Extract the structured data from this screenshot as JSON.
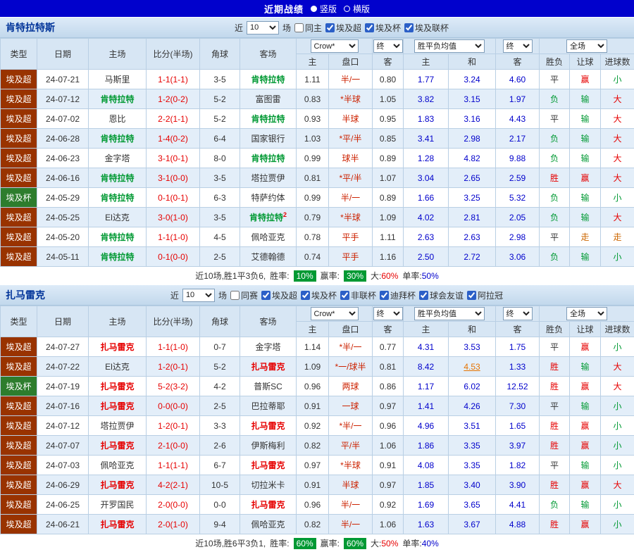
{
  "topbar": {
    "title": "近期战绩",
    "layout_options": [
      {
        "label": "竖版",
        "selected": true
      },
      {
        "label": "横版",
        "selected": false
      }
    ]
  },
  "filter_common": {
    "near": "近",
    "count": "10",
    "games": "场"
  },
  "table_header": {
    "type": "类型",
    "date": "日期",
    "home": "主场",
    "score": "比分(半场)",
    "corner": "角球",
    "away": "客场",
    "odds_source": "Crow*",
    "final": "终",
    "avg": "胜平负均值",
    "scope": "全场",
    "asian_home": "主",
    "handicap": "盘口",
    "asian_away": "客",
    "euro_home": "主",
    "euro_draw": "和",
    "euro_away": "客",
    "result": "胜负",
    "handicap_result": "让球",
    "goals": "进球数"
  },
  "colors": {
    "topbar_blue": "#0101cc",
    "league_super_bg": "#993300",
    "league_cup_bg": "#2d7d2d",
    "team1_highlight": "#009933",
    "team2_highlight": "#e60000",
    "handicap_red": "#cc2200",
    "euro_odds_blue": "#0000cc",
    "badge_green": "#009933",
    "push_orange": "#cc6600"
  },
  "sections": [
    {
      "team": "肯特拉特斯",
      "filter": {
        "same": {
          "label": "同主",
          "checked": false
        },
        "leagues": [
          {
            "label": "埃及超",
            "checked": true
          },
          {
            "label": "埃及杯",
            "checked": true
          },
          {
            "label": "埃及联杯",
            "checked": true
          }
        ]
      },
      "rows": [
        {
          "type": "埃及超",
          "type_cls": "super",
          "date": "24-07-21",
          "home": "马斯里",
          "home_hl": false,
          "score": "1-1(1-1)",
          "corner": "3-5",
          "away": "肯特拉特",
          "away_hl": true,
          "ah": "1.11",
          "hc": "半/一",
          "aa": "0.80",
          "eh": "1.77",
          "ed": "3.24",
          "ea": "4.60",
          "r1": "平",
          "r2": "赢",
          "r3": "小"
        },
        {
          "type": "埃及超",
          "type_cls": "super",
          "date": "24-07-12",
          "home": "肯特拉特",
          "home_hl": true,
          "score": "1-2(0-2)",
          "corner": "5-2",
          "away": "富图雷",
          "away_hl": false,
          "ah": "0.83",
          "hc": "*半球",
          "aa": "1.05",
          "eh": "3.82",
          "ed": "3.15",
          "ea": "1.97",
          "r1": "负",
          "r2": "输",
          "r3": "大"
        },
        {
          "type": "埃及超",
          "type_cls": "super",
          "date": "24-07-02",
          "home": "恩比",
          "home_hl": false,
          "score": "2-2(1-1)",
          "corner": "5-2",
          "away": "肯特拉特",
          "away_hl": true,
          "ah": "0.93",
          "hc": "半球",
          "aa": "0.95",
          "eh": "1.83",
          "ed": "3.16",
          "ea": "4.43",
          "r1": "平",
          "r2": "输",
          "r3": "大"
        },
        {
          "type": "埃及超",
          "type_cls": "super",
          "date": "24-06-28",
          "home": "肯特拉特",
          "home_hl": true,
          "score": "1-4(0-2)",
          "corner": "6-4",
          "away": "国家银行",
          "away_hl": false,
          "ah": "1.03",
          "hc": "*平/半",
          "aa": "0.85",
          "eh": "3.41",
          "ed": "2.98",
          "ea": "2.17",
          "r1": "负",
          "r2": "输",
          "r3": "大"
        },
        {
          "type": "埃及超",
          "type_cls": "super",
          "date": "24-06-23",
          "home": "金字塔",
          "home_hl": false,
          "score": "3-1(0-1)",
          "corner": "8-0",
          "away": "肯特拉特",
          "away_hl": true,
          "ah": "0.99",
          "hc": "球半",
          "aa": "0.89",
          "eh": "1.28",
          "ed": "4.82",
          "ea": "9.88",
          "r1": "负",
          "r2": "输",
          "r3": "大"
        },
        {
          "type": "埃及超",
          "type_cls": "super",
          "date": "24-06-16",
          "home": "肯特拉特",
          "home_hl": true,
          "score": "3-1(0-0)",
          "corner": "3-5",
          "away": "塔拉贾伊",
          "away_hl": false,
          "ah": "0.81",
          "hc": "*平/半",
          "aa": "1.07",
          "eh": "3.04",
          "ed": "2.65",
          "ea": "2.59",
          "r1": "胜",
          "r2": "赢",
          "r3": "大"
        },
        {
          "type": "埃及杯",
          "type_cls": "cup",
          "date": "24-05-29",
          "home": "肯特拉特",
          "home_hl": true,
          "score": "0-1(0-1)",
          "corner": "6-3",
          "away": "特萨约体",
          "away_hl": false,
          "ah": "0.99",
          "hc": "半/一",
          "aa": "0.89",
          "eh": "1.66",
          "ed": "3.25",
          "ea": "5.32",
          "r1": "负",
          "r2": "输",
          "r3": "小"
        },
        {
          "type": "埃及超",
          "type_cls": "super",
          "date": "24-05-25",
          "home": "El达克",
          "home_hl": false,
          "score": "3-0(1-0)",
          "corner": "3-5",
          "away": "肯特拉特",
          "away_hl": true,
          "away_sup": "2",
          "ah": "0.79",
          "hc": "*半球",
          "aa": "1.09",
          "eh": "4.02",
          "ed": "2.81",
          "ea": "2.05",
          "r1": "负",
          "r2": "输",
          "r3": "大"
        },
        {
          "type": "埃及超",
          "type_cls": "super",
          "date": "24-05-20",
          "home": "肯特拉特",
          "home_hl": true,
          "score": "1-1(1-0)",
          "corner": "4-5",
          "away": "佩哈亚克",
          "away_hl": false,
          "ah": "0.78",
          "hc": "平手",
          "aa": "1.11",
          "eh": "2.63",
          "ed": "2.63",
          "ea": "2.98",
          "r1": "平",
          "r2": "走",
          "r3": "走"
        },
        {
          "type": "埃及超",
          "type_cls": "super",
          "date": "24-05-11",
          "home": "肯特拉特",
          "home_hl": true,
          "score": "0-1(0-0)",
          "corner": "2-5",
          "away": "艾德翰德",
          "away_hl": false,
          "ah": "0.74",
          "hc": "平手",
          "aa": "1.16",
          "eh": "2.50",
          "ed": "2.72",
          "ea": "3.06",
          "r1": "负",
          "r2": "输",
          "r3": "小"
        }
      ],
      "footer": {
        "summary": "近10场,胜1平3负6,",
        "win_label": "胜率:",
        "win_rate": "10%",
        "profit_label": "赢率:",
        "profit_rate": "30%",
        "big_label": "大:",
        "big_rate": "60%",
        "single_label": "单率:",
        "single_rate": "50%"
      }
    },
    {
      "team": "扎马雷克",
      "filter": {
        "same": {
          "label": "同赛",
          "checked": false
        },
        "leagues": [
          {
            "label": "埃及超",
            "checked": true
          },
          {
            "label": "埃及杯",
            "checked": true
          },
          {
            "label": "非联杯",
            "checked": true
          },
          {
            "label": "迪拜杯",
            "checked": true
          },
          {
            "label": "球会友谊",
            "checked": true
          },
          {
            "label": "阿拉冠",
            "checked": true
          }
        ]
      },
      "rows": [
        {
          "type": "埃及超",
          "type_cls": "super",
          "date": "24-07-27",
          "home": "扎马雷克",
          "home_hl": true,
          "score": "1-1(1-0)",
          "corner": "0-7",
          "away": "金字塔",
          "away_hl": false,
          "ah": "1.14",
          "hc": "*半/一",
          "aa": "0.77",
          "eh": "4.31",
          "ed": "3.53",
          "ea": "1.75",
          "r1": "平",
          "r2": "赢",
          "r3": "小"
        },
        {
          "type": "埃及超",
          "type_cls": "super",
          "date": "24-07-22",
          "home": "El达克",
          "home_hl": false,
          "score": "1-2(0-1)",
          "corner": "5-2",
          "away": "扎马雷克",
          "away_hl": true,
          "ah": "1.09",
          "hc": "*一/球半",
          "aa": "0.81",
          "eh": "8.42",
          "ed": "4.53",
          "ed_hl": true,
          "ea": "1.33",
          "r1": "胜",
          "r2": "输",
          "r3": "大"
        },
        {
          "type": "埃及杯",
          "type_cls": "cup",
          "date": "24-07-19",
          "home": "扎马雷克",
          "home_hl": true,
          "score": "5-2(3-2)",
          "corner": "4-2",
          "away": "普斯SC",
          "away_hl": false,
          "ah": "0.96",
          "hc": "两球",
          "aa": "0.86",
          "eh": "1.17",
          "ed": "6.02",
          "ea": "12.52",
          "r1": "胜",
          "r2": "赢",
          "r3": "大"
        },
        {
          "type": "埃及超",
          "type_cls": "super",
          "date": "24-07-16",
          "home": "扎马雷克",
          "home_hl": true,
          "score": "0-0(0-0)",
          "corner": "2-5",
          "away": "巴拉蒂耶",
          "away_hl": false,
          "ah": "0.91",
          "hc": "一球",
          "aa": "0.97",
          "eh": "1.41",
          "ed": "4.26",
          "ea": "7.30",
          "r1": "平",
          "r2": "输",
          "r3": "小"
        },
        {
          "type": "埃及超",
          "type_cls": "super",
          "date": "24-07-12",
          "home": "塔拉贾伊",
          "home_hl": false,
          "score": "1-2(0-1)",
          "corner": "3-3",
          "away": "扎马雷克",
          "away_hl": true,
          "ah": "0.92",
          "hc": "*半/一",
          "aa": "0.96",
          "eh": "4.96",
          "ed": "3.51",
          "ea": "1.65",
          "r1": "胜",
          "r2": "赢",
          "r3": "小"
        },
        {
          "type": "埃及超",
          "type_cls": "super",
          "date": "24-07-07",
          "home": "扎马雷克",
          "home_hl": true,
          "score": "2-1(0-0)",
          "corner": "2-6",
          "away": "伊斯梅利",
          "away_hl": false,
          "ah": "0.82",
          "hc": "平/半",
          "aa": "1.06",
          "eh": "1.86",
          "ed": "3.35",
          "ea": "3.97",
          "r1": "胜",
          "r2": "赢",
          "r3": "小"
        },
        {
          "type": "埃及超",
          "type_cls": "super",
          "date": "24-07-03",
          "home": "佩哈亚克",
          "home_hl": false,
          "score": "1-1(1-1)",
          "corner": "6-7",
          "away": "扎马雷克",
          "away_hl": true,
          "ah": "0.97",
          "hc": "*半球",
          "aa": "0.91",
          "eh": "4.08",
          "ed": "3.35",
          "ea": "1.82",
          "r1": "平",
          "r2": "输",
          "r3": "小"
        },
        {
          "type": "埃及超",
          "type_cls": "super",
          "date": "24-06-29",
          "home": "扎马雷克",
          "home_hl": true,
          "score": "4-2(2-1)",
          "corner": "10-5",
          "away": "切拉米卡",
          "away_hl": false,
          "ah": "0.91",
          "hc": "半球",
          "aa": "0.97",
          "eh": "1.85",
          "ed": "3.40",
          "ea": "3.90",
          "r1": "胜",
          "r2": "赢",
          "r3": "大"
        },
        {
          "type": "埃及超",
          "type_cls": "super",
          "date": "24-06-25",
          "home": "开罗国民",
          "home_hl": false,
          "score": "2-0(0-0)",
          "corner": "0-0",
          "away": "扎马雷克",
          "away_hl": true,
          "ah": "0.96",
          "hc": "半/一",
          "aa": "0.92",
          "eh": "1.69",
          "ed": "3.65",
          "ea": "4.41",
          "r1": "负",
          "r2": "输",
          "r3": "小"
        },
        {
          "type": "埃及超",
          "type_cls": "super",
          "date": "24-06-21",
          "home": "扎马雷克",
          "home_hl": true,
          "score": "2-0(1-0)",
          "corner": "9-4",
          "away": "佩哈亚克",
          "away_hl": false,
          "ah": "0.82",
          "hc": "半/一",
          "aa": "1.06",
          "eh": "1.63",
          "ed": "3.67",
          "ea": "4.88",
          "r1": "胜",
          "r2": "赢",
          "r3": "小"
        }
      ],
      "footer": {
        "summary": "近10场,胜6平3负1,",
        "win_label": "胜率:",
        "win_rate": "60%",
        "profit_label": "赢率:",
        "profit_rate": "60%",
        "big_label": "大:",
        "big_rate": "50%",
        "single_label": "单率:",
        "single_rate": "40%"
      }
    }
  ]
}
